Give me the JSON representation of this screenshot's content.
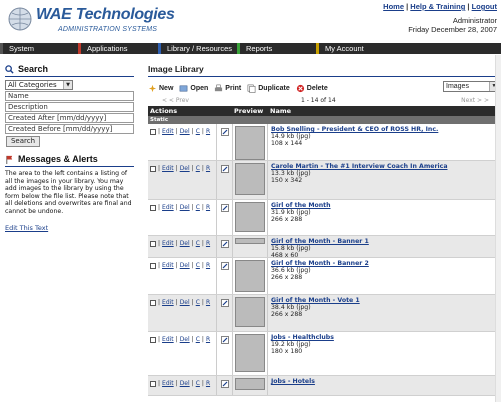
{
  "header": {
    "brand": "WAE Technologies",
    "brand_sub": "ADMINISTRATION SYSTEMS",
    "links": [
      "Home",
      "Help & Training",
      "Logout"
    ],
    "user_role": "Administrator",
    "date": "Friday December 28, 2007"
  },
  "nav": [
    {
      "label": "System",
      "color": "#555555"
    },
    {
      "label": "Applications",
      "color": "#c0392b"
    },
    {
      "label": "Library / Resources",
      "color": "#2e5fb0"
    },
    {
      "label": "Reports",
      "color": "#3aa33a"
    },
    {
      "label": "My Account",
      "color": "#c8a000"
    }
  ],
  "sidebar": {
    "search_title": "Search",
    "category_select": "All Categories",
    "fields": [
      "Name",
      "Description",
      "Created After [mm/dd/yyyy]",
      "Created Before [mm/dd/yyyy]"
    ],
    "search_button": "Search",
    "messages_title": "Messages & Alerts",
    "message": "The area to the left contains a listing of all the images in your library. You may add images to the library by using the form below the file list. Please note that all deletions and overwrites are final and cannot be undone.",
    "edit_link": "Edit This Text"
  },
  "main": {
    "title": "Image Library",
    "toolbar": [
      "New",
      "Open",
      "Print",
      "Duplicate",
      "Delete"
    ],
    "filter_select": "Images",
    "pager": {
      "prev": "< < Prev",
      "count": "1 - 14 of 14",
      "next": "Next > >"
    },
    "columns": [
      "Actions",
      "Preview",
      "Name"
    ],
    "group": "Static",
    "actions": [
      "Edit",
      "Del",
      "C",
      "R"
    ],
    "rows": [
      {
        "name": "Bob Snelling - President & CEO of ROSS HR, Inc.",
        "size": "14.9 kb (jpg)",
        "dims": "108 x 144"
      },
      {
        "name": "Carole Martin - The #1 Interview Coach In America",
        "size": "13.3 kb (jpg)",
        "dims": "150 x 342"
      },
      {
        "name": "Girl of the Month",
        "size": "31.9 kb (jpg)",
        "dims": "266 x 288"
      },
      {
        "name": "Girl of the Month - Banner 1",
        "size": "15.8 kb (jpg)",
        "dims": "468 x 60"
      },
      {
        "name": "Girl of the Month - Banner 2",
        "size": "36.6 kb (jpg)",
        "dims": "266 x 288"
      },
      {
        "name": "Girl of the Month - Vote 1",
        "size": "38.4 kb (jpg)",
        "dims": "266 x 288"
      },
      {
        "name": "Jobs - Healthclubs",
        "size": "19.2 kb (jpg)",
        "dims": "180 x 180"
      },
      {
        "name": "Jobs - Hotels",
        "size": "",
        "dims": ""
      }
    ]
  }
}
